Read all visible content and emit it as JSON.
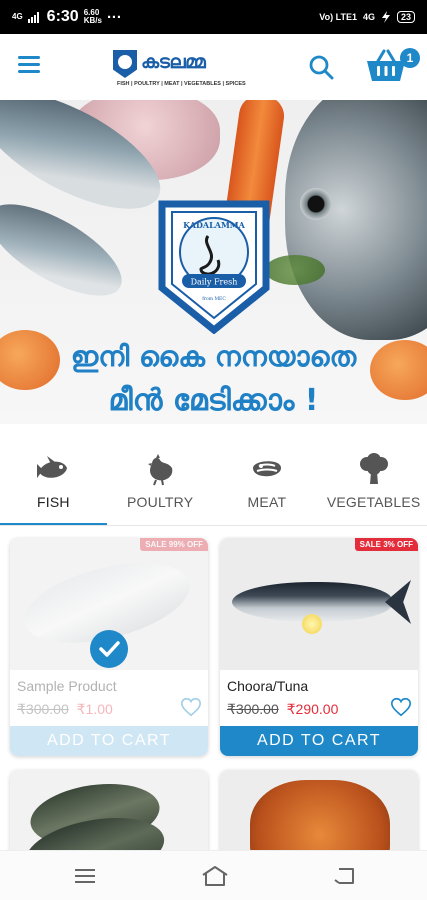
{
  "status_bar": {
    "network_left": "4G",
    "time": "6:30",
    "speed_value": "6.60",
    "speed_unit": "KB/s",
    "more": "···",
    "volte": "Vo) LTE1",
    "network_right": "4G",
    "battery": "23"
  },
  "header": {
    "logo_text": "കടലമ്മ",
    "logo_subtitle": "FISH | POULTRY | MEAT | VEGETABLES | SPICES",
    "cart_count": "1"
  },
  "banner": {
    "badge_brand": "KADALAMMA",
    "badge_tagline": "Daily Fresh",
    "badge_from": "from MEC",
    "tagline_line1": "ഇനി കൈ നനയാതെ",
    "tagline_line2": "മീൻ മേടിക്കാം !"
  },
  "categories": [
    {
      "label": "FISH",
      "icon": "fish-icon",
      "active": true
    },
    {
      "label": "POULTRY",
      "icon": "chicken-icon",
      "active": false
    },
    {
      "label": "MEAT",
      "icon": "meat-icon",
      "active": false
    },
    {
      "label": "VEGETABLES",
      "icon": "broccoli-icon",
      "active": false
    }
  ],
  "products": [
    {
      "name": "Sample Product",
      "sale_badge": "SALE 99% OFF",
      "old_price": "₹300.00",
      "new_price": "₹1.00",
      "cta": "ADD TO CART",
      "state": "added"
    },
    {
      "name": "Choora/Tuna",
      "sale_badge": "SALE 3% OFF",
      "old_price": "₹300.00",
      "new_price": "₹290.00",
      "cta": "ADD TO CART",
      "state": "normal"
    }
  ],
  "colors": {
    "accent": "#1e88c8",
    "sale": "#e32d3a",
    "brand_dark": "#1a5ea8"
  }
}
